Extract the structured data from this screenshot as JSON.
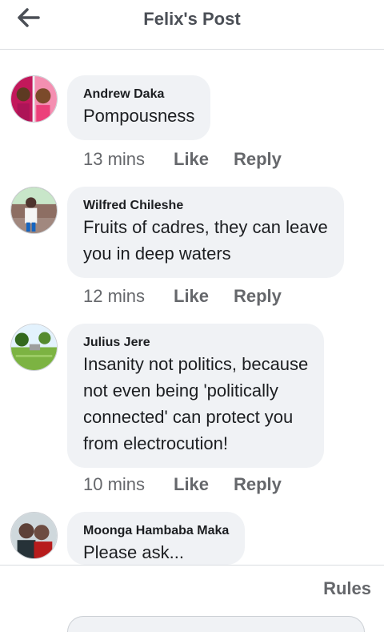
{
  "header": {
    "title": "Felix's Post",
    "back_icon": "arrow-left-icon"
  },
  "comments": [
    {
      "author": "Andrew Daka",
      "lines": [
        "Pompousness"
      ],
      "time": "13 mins",
      "like": "Like",
      "reply": "Reply"
    },
    {
      "author": "Wilfred Chileshe",
      "lines": [
        "Fruits of cadres, they can leave",
        "you in deep waters"
      ],
      "time": "12 mins",
      "like": "Like",
      "reply": "Reply"
    },
    {
      "author": "Julius Jere",
      "lines": [
        "Insanity not politics, because",
        "not even being 'politically",
        "connected' can protect you",
        "from electrocution!"
      ],
      "time": "10 mins",
      "like": "Like",
      "reply": "Reply"
    },
    {
      "author": "Moonga Hambaba Maka",
      "lines": [
        "Please ask..."
      ]
    }
  ],
  "footer": {
    "rules": "Rules"
  }
}
